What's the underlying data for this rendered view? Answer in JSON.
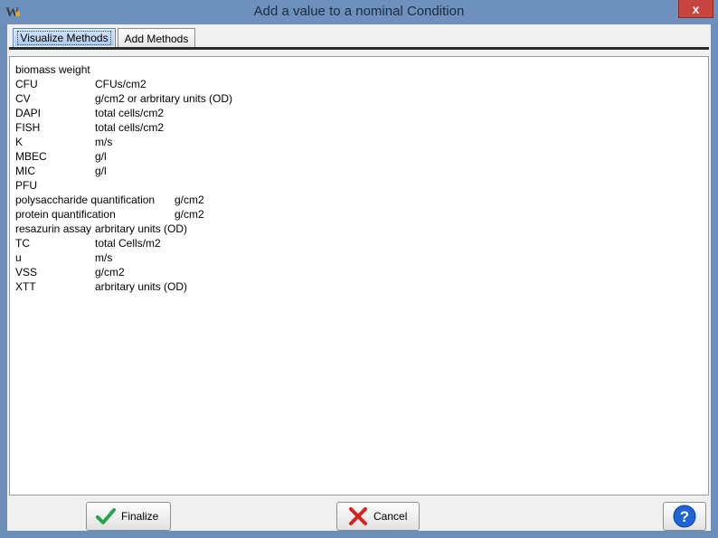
{
  "window": {
    "title": "Add a value to a nominal Condition",
    "close_glyph": "x",
    "app_icon": "app-w-icon"
  },
  "tabs": [
    {
      "label": "Visualize Methods",
      "active": true
    },
    {
      "label": "Add Methods",
      "active": false
    }
  ],
  "methods": [
    {
      "name": "biomass weight",
      "unit": ""
    },
    {
      "name": "CFU",
      "unit": "CFUs/cm2"
    },
    {
      "name": "CV",
      "unit": "g/cm2 or arbritary units (OD)"
    },
    {
      "name": "DAPI",
      "unit": "total cells/cm2"
    },
    {
      "name": "FISH",
      "unit": "total cells/cm2"
    },
    {
      "name": "K",
      "unit": "m/s"
    },
    {
      "name": "MBEC",
      "unit": "g/l"
    },
    {
      "name": "MIC",
      "unit": "g/l"
    },
    {
      "name": "PFU",
      "unit": ""
    },
    {
      "name": "polysaccharide quantification",
      "unit": "g/cm2"
    },
    {
      "name": "protein quantification",
      "unit": "g/cm2"
    },
    {
      "name": "resazurin assay",
      "unit": "arbritary units (OD)"
    },
    {
      "name": "TC",
      "unit": "total Cells/m2"
    },
    {
      "name": "u",
      "unit": "m/s"
    },
    {
      "name": "VSS",
      "unit": "g/cm2"
    },
    {
      "name": "XTT",
      "unit": "arbritary units (OD)"
    }
  ],
  "buttons": {
    "finalize": {
      "label": "Finalize",
      "icon": "checkmark-icon"
    },
    "cancel": {
      "label": "Cancel",
      "icon": "x-mark-icon"
    },
    "help": {
      "icon": "question-icon"
    }
  },
  "colors": {
    "titlebar": "#6d90bd",
    "close": "#c7443f",
    "check": "#2aa44a",
    "cross": "#d6231d",
    "help": "#1f64d6"
  }
}
